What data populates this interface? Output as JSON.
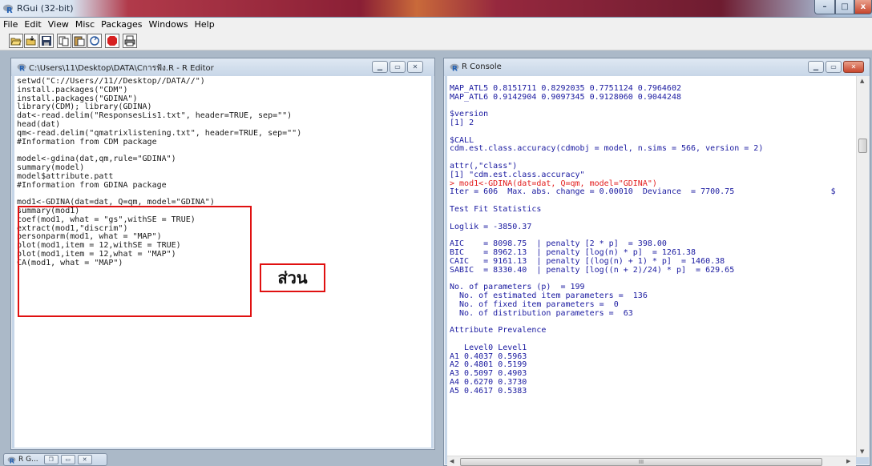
{
  "window": {
    "title": "RGui (32-bit)",
    "min": "–",
    "max": "□",
    "close": "x"
  },
  "menu": [
    "File",
    "Edit",
    "View",
    "Misc",
    "Packages",
    "Windows",
    "Help"
  ],
  "toolbar": {
    "icons": [
      "open-script-icon",
      "load-workspace-icon",
      "save-icon",
      "copy-icon",
      "paste-icon",
      "copy-paste-icon",
      "stop-icon",
      "print-icon"
    ]
  },
  "editor": {
    "title": "C:\\Users\\11\\Desktop\\DATA\\Cการฟัง.R - R Editor",
    "lines": [
      "setwd(\"C://Users//11//Desktop//DATA//\")",
      "install.packages(\"CDM\")",
      "install.packages(\"GDINA\")",
      "library(CDM); library(GDINA)",
      "dat<-read.delim(\"ResponsesLis1.txt\", header=TRUE, sep=\"\")",
      "head(dat)",
      "qm<-read.delim(\"qmatrixlistening.txt\", header=TRUE, sep=\"\")",
      "#Information from CDM package",
      "",
      "model<-gdina(dat,qm,rule=\"GDINA\")",
      "summary(model)",
      "model$attribute.patt",
      "#Information from GDINA package",
      "",
      "mod1<-GDINA(dat=dat, Q=qm, model=\"GDINA\")",
      "summary(mod1)",
      "coef(mod1, what = \"gs\",withSE = TRUE)",
      "extract(mod1,\"discrim\")",
      "personparm(mod1, what = \"MAP\")",
      "plot(mod1,item = 12,withSE = TRUE)",
      "plot(mod1,item = 12,what = \"MAP\")",
      "CA(mod1, what = \"MAP\")"
    ],
    "annotation": "ส่วน"
  },
  "console": {
    "title": "R Console",
    "lines": [
      "",
      "MAP_ATL5 0.8151711 0.8292035 0.7751124 0.7964602",
      "MAP_ATL6 0.9142904 0.9097345 0.9128060 0.9044248",
      "",
      "$version",
      "[1] 2",
      "",
      "$CALL",
      "cdm.est.class.accuracy(cdmobj = model, n.sims = 566, version = 2)",
      "",
      "attr(,\"class\")",
      "[1] \"cdm.est.class.accuracy\"",
      "> mod1<-GDINA(dat=dat, Q=qm, model=\"GDINA\")",
      "Iter = 606  Max. abs. change = 0.00010  Deviance  = 7700.75                    $",
      "",
      "Test Fit Statistics",
      "",
      "Loglik = -3850.37",
      "",
      "AIC    = 8098.75  | penalty [2 * p]  = 398.00",
      "BIC    = 8962.13  | penalty [log(n) * p]  = 1261.38",
      "CAIC   = 9161.13  | penalty [(log(n) + 1) * p]  = 1460.38",
      "SABIC  = 8330.40  | penalty [log((n + 2)/24) * p]  = 629.65",
      "",
      "No. of parameters (p)  = 199",
      "  No. of estimated item parameters =  136",
      "  No. of fixed item parameters =  0",
      "  No. of distribution parameters =  63",
      "",
      "Attribute Prevalence",
      "",
      "   Level0 Level1",
      "A1 0.4037 0.5963",
      "A2 0.4801 0.5199",
      "A3 0.5097 0.4903",
      "A4 0.6270 0.3730",
      "A5 0.4617 0.5383"
    ],
    "red_line_index": 12,
    "hscroll_label": "III"
  },
  "minimized": {
    "label": "R G..."
  }
}
